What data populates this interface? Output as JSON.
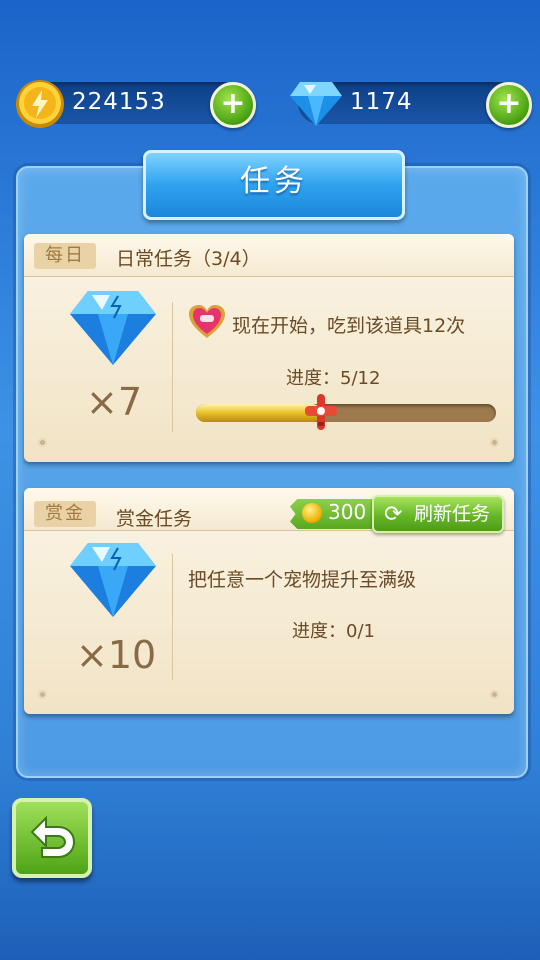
{
  "currency": {
    "gold": {
      "value": "224153",
      "icon": "gold-coin-icon"
    },
    "diamond": {
      "value": "1174",
      "icon": "diamond-icon"
    },
    "add_icon": "plus-icon"
  },
  "panel": {
    "title": "任务"
  },
  "tasks": [
    {
      "tag": "每日",
      "title": "日常任务（3/4）",
      "reward_multiplier": "×7",
      "reward_icon": "diamond-icon",
      "item_icon": "heart-item-icon",
      "description": "现在开始，吃到该道具12次",
      "progress_text": "进度：5/12",
      "progress_fraction": 0.4167
    },
    {
      "tag": "赏金",
      "title": "赏金任务",
      "reward_multiplier": "×10",
      "reward_icon": "diamond-icon",
      "description": "把任意一个宠物提升至满级",
      "progress_text": "进度：0/1",
      "refresh_cost": "300",
      "refresh_label": "刷新任务"
    }
  ],
  "back_icon": "back-arrow-icon",
  "colors": {
    "accent_green": "#66b827",
    "panel_blue": "#4d9be4",
    "card_bg": "#f1e3c5",
    "text_brown": "#6b4a25"
  }
}
